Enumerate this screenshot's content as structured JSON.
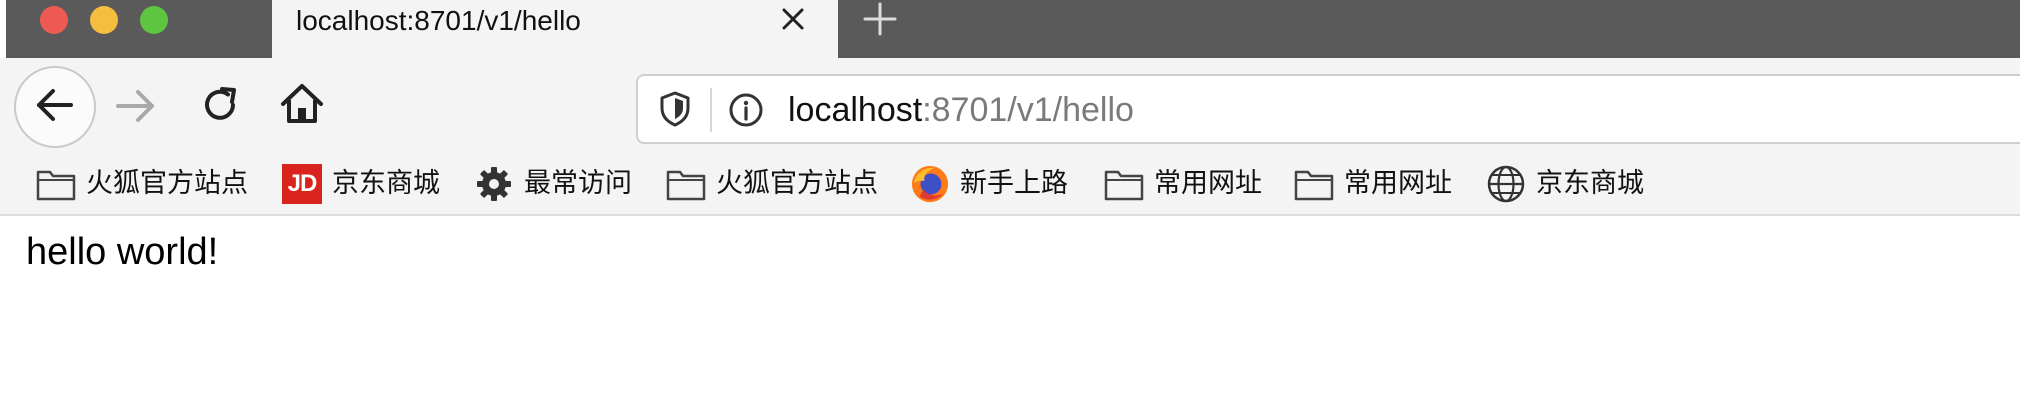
{
  "window": {
    "traffic_lights": {
      "close_color": "#ee5a52",
      "minimize_color": "#f5be3e",
      "zoom_color": "#5ec541"
    }
  },
  "tab": {
    "title": "localhost:8701/v1/hello",
    "close_icon": "close-icon",
    "new_tab_icon": "plus-icon"
  },
  "toolbar": {
    "back_icon": "arrow-left-icon",
    "forward_icon": "arrow-right-icon",
    "reload_icon": "reload-icon",
    "home_icon": "home-icon"
  },
  "urlbar": {
    "host": "localhost",
    "path": ":8701/v1/hello",
    "tracking_icon": "shield-icon",
    "info_icon": "info-icon"
  },
  "bookmarks": [
    {
      "label": "火狐官方站点",
      "icon": "folder-icon"
    },
    {
      "label": "京东商城",
      "icon": "jd-logo-icon",
      "icon_text": "JD"
    },
    {
      "label": "最常访问",
      "icon": "gear-icon"
    },
    {
      "label": "火狐官方站点",
      "icon": "folder-icon"
    },
    {
      "label": "新手上路",
      "icon": "firefox-icon"
    },
    {
      "label": "常用网址",
      "icon": "folder-icon"
    },
    {
      "label": "常用网址",
      "icon": "folder-icon"
    },
    {
      "label": "京东商城",
      "icon": "globe-icon"
    }
  ],
  "content": {
    "text": "hello world!"
  }
}
